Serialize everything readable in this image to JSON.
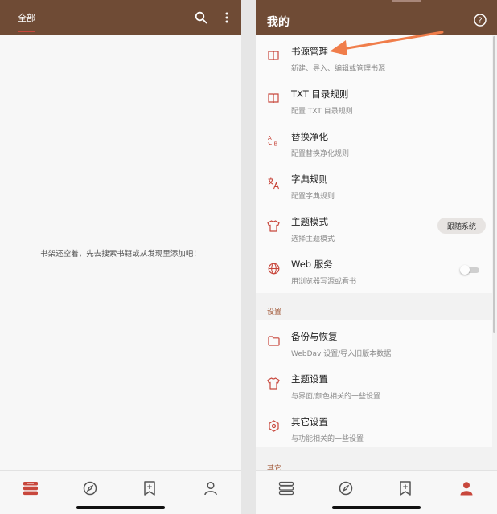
{
  "left": {
    "tab_all": "全部",
    "empty_message": "书架还空着，先去搜索书籍或从发现里添加吧！",
    "nav": [
      "bookshelf-icon",
      "discover-icon",
      "rss-icon",
      "my-icon"
    ]
  },
  "right": {
    "title": "我的",
    "items_main": [
      {
        "title": "书源管理",
        "subtitle": "新建、导入、编辑或管理书源",
        "icon": "book-icon"
      },
      {
        "title": "TXT 目录规则",
        "subtitle": "配置 TXT 目录规则",
        "icon": "book-icon"
      },
      {
        "title": "替换净化",
        "subtitle": "配置替换净化规则",
        "icon": "replace-icon"
      },
      {
        "title": "字典规则",
        "subtitle": "配置字典规则",
        "icon": "translate-icon"
      },
      {
        "title": "主题模式",
        "subtitle": "选择主题模式",
        "icon": "shirt-icon"
      },
      {
        "title": "Web 服务",
        "subtitle": "用浏览器写源或看书",
        "icon": "globe-icon"
      }
    ],
    "theme_mode_value": "跟随系统",
    "section_settings": "设置",
    "items_settings": [
      {
        "title": "备份与恢复",
        "subtitle": "WebDav 设置/导入旧版本数据",
        "icon": "folder-icon"
      },
      {
        "title": "主题设置",
        "subtitle": "与界面/颜色相关的一些设置",
        "icon": "shirt-icon"
      },
      {
        "title": "其它设置",
        "subtitle": "与功能相关的一些设置",
        "icon": "settings-hex-icon"
      }
    ],
    "section_other": "其它"
  },
  "colors": {
    "appbar": "#6f4b35",
    "accent": "#c8473c",
    "arrow": "#f07d4a"
  }
}
